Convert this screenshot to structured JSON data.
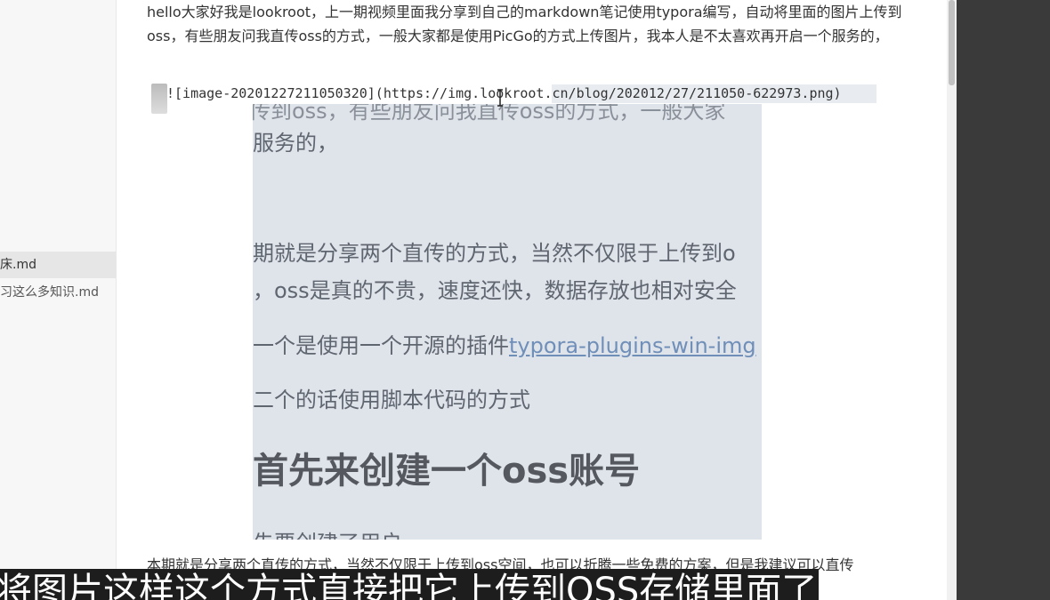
{
  "sidebar": {
    "items": [
      {
        "label": "床.md",
        "active": true
      },
      {
        "label": "习这么多知识.md",
        "active": false
      }
    ]
  },
  "editor": {
    "paragraph1": "hello大家好我是lookroot，上一期视频里面我分享到自己的markdown笔记使用typora编写，自动将里面的图片上传到oss，有些朋友问我直传oss的方式，一般大家都是使用PicGo的方式上传图片，我本人是不太喜欢再开启一个服务的，",
    "image_markdown": "![image-20201227211050320](https://img.lookroot.cn/blog/202012/27/211050-622973.png)",
    "bottom_paragraph": "本期就是分享两个直传的方式，当然不仅限于上传到oss空间，也可以折腾一些免费的方案，但是我建议可以直传"
  },
  "preview": {
    "line_top": "传到oss，有些朋友问我直传oss的方式，一般大家",
    "line1": "服务的，",
    "line2": "期就是分享两个直传的方式，当然不仅限于上传到o",
    "line3": "，oss是真的不贵，速度还快，数据存放也相对安全",
    "line4_prefix": "一个是使用一个开源的插件",
    "line4_link": "typora-plugins-win-img",
    "line5": "二个的话使用脚本代码的方式",
    "heading": "首先来创建一个oss账号",
    "line_bottom": "先要创建了用户"
  },
  "subtitle": "将图片这样这个方式直接把它上传到OSS存储里面了",
  "colors": {
    "sidebar_bg": "#f7f7f7",
    "preview_bg": "#dfe3ea",
    "link": "#6f8fb9",
    "subtitle_bg": "#1d1d1d"
  }
}
